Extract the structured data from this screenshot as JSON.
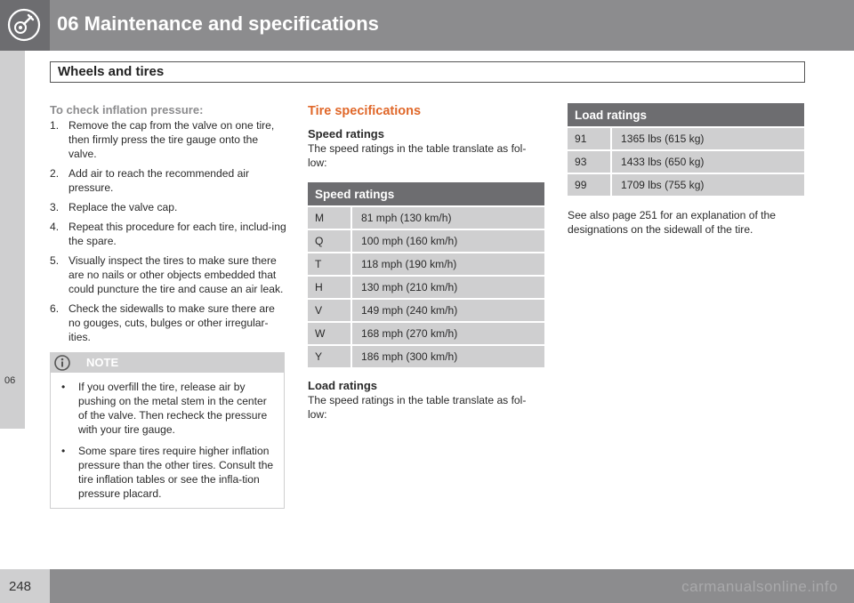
{
  "header": {
    "chapter_title": "06 Maintenance and specifications",
    "section_title": "Wheels and tires",
    "icon": "wrench-gear-icon"
  },
  "side_tab": {
    "label": "06"
  },
  "footer": {
    "page_number": "248",
    "watermark": "carmanualsonline.info"
  },
  "column1": {
    "heading": "To check inflation pressure:",
    "steps": [
      {
        "num": "1.",
        "text": "Remove the cap from the valve on one tire, then firmly press the tire gauge onto the valve."
      },
      {
        "num": "2.",
        "text": "Add air to reach the recommended air pressure."
      },
      {
        "num": "3.",
        "text": "Replace the valve cap."
      },
      {
        "num": "4.",
        "text": "Repeat this procedure for each tire, includ-ing the spare."
      },
      {
        "num": "5.",
        "text": "Visually inspect the tires to make sure there are no nails or other objects embedded that could puncture the tire and cause an air leak."
      },
      {
        "num": "6.",
        "text": "Check the sidewalls to make sure there are no gouges, cuts, bulges or other irregular-ities."
      }
    ],
    "note": {
      "label": "NOTE",
      "icon": "info-icon",
      "items": [
        "If you overfill the tire, release air by pushing on the metal stem in the center of the valve. Then recheck the pressure with your tire gauge.",
        "Some spare tires require higher inflation pressure than the other tires. Consult the tire inflation tables or see the infla-tion pressure placard."
      ]
    }
  },
  "column2": {
    "heading": "Tire specifications",
    "speed_subhead": "Speed ratings",
    "speed_intro": "The speed ratings in the table translate as fol-low:",
    "speed_table": {
      "title": "Speed ratings",
      "rows": [
        {
          "code": "M",
          "value": "81 mph (130 km/h)"
        },
        {
          "code": "Q",
          "value": "100 mph (160 km/h)"
        },
        {
          "code": "T",
          "value": "118 mph (190 km/h)"
        },
        {
          "code": "H",
          "value": "130 mph (210 km/h)"
        },
        {
          "code": "V",
          "value": "149 mph (240 km/h)"
        },
        {
          "code": "W",
          "value": "168 mph (270 km/h)"
        },
        {
          "code": "Y",
          "value": "186 mph (300 km/h)"
        }
      ]
    },
    "load_subhead": "Load ratings",
    "load_intro": "The speed ratings in the table translate as fol-low:"
  },
  "column3": {
    "load_table": {
      "title": "Load ratings",
      "rows": [
        {
          "code": "91",
          "value": "1365 lbs (615 kg)"
        },
        {
          "code": "93",
          "value": "1433 lbs (650 kg)"
        },
        {
          "code": "99",
          "value": "1709 lbs (755 kg)"
        }
      ]
    },
    "see_also": "See also page 251 for an explanation of the designations on the sidewall of the tire."
  },
  "colors": {
    "header_gray": "#8c8c8e",
    "dark_gray": "#6d6d70",
    "light_gray": "#cfcfd0",
    "accent_orange": "#e0682a"
  }
}
